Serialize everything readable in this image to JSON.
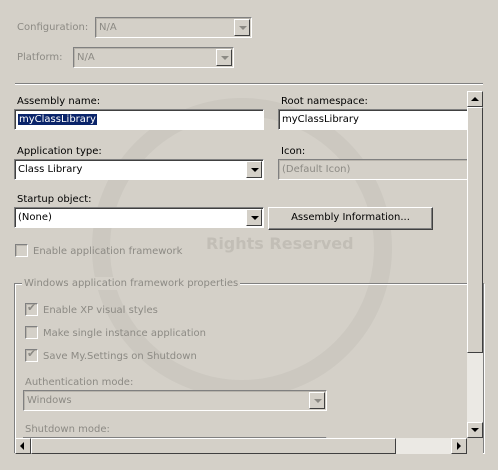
{
  "top": {
    "configuration_label": "Configuration:",
    "configuration_value": "N/A",
    "platform_label": "Platform:",
    "platform_value": "N/A"
  },
  "form": {
    "assembly_name_label": "Assembly name:",
    "assembly_name_value": "myClassLibrary",
    "root_namespace_label": "Root namespace:",
    "root_namespace_value": "myClassLibrary",
    "application_type_label": "Application type:",
    "application_type_value": "Class Library",
    "icon_label": "Icon:",
    "icon_value": "(Default Icon)",
    "startup_object_label": "Startup object:",
    "startup_object_value": "(None)",
    "assembly_info_button": "Assembly Information...",
    "enable_framework_label": "Enable application framework"
  },
  "framework_group": {
    "title": "Windows application framework properties",
    "xp_styles_label": "Enable XP visual styles",
    "single_instance_label": "Make single instance application",
    "save_settings_label": "Save My.Settings on Shutdown",
    "auth_mode_label": "Authentication mode:",
    "auth_mode_value": "Windows",
    "shutdown_mode_label": "Shutdown mode:"
  },
  "watermark": {
    "line1": "Rights Reserved"
  },
  "icons": {
    "dropdown": "chevron-down-icon",
    "check": "check-icon"
  }
}
